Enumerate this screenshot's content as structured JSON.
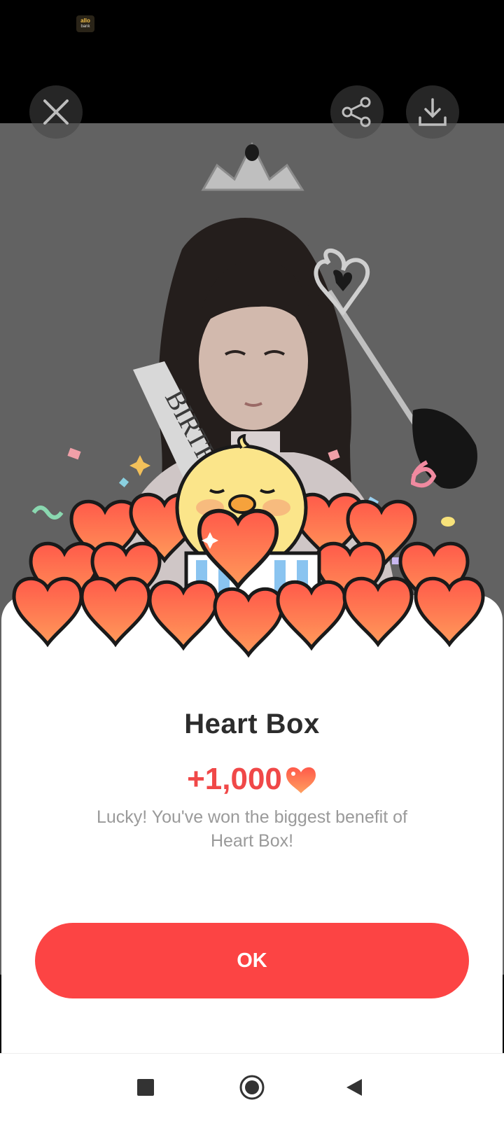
{
  "status_bar": {
    "app_badge_top": "allo",
    "app_badge_bottom": "bank"
  },
  "toolbar": {
    "close_icon": "close-icon",
    "share_icon": "share-icon",
    "download_icon": "download-icon"
  },
  "photo": {
    "sash_text": "BIRTH"
  },
  "dialog": {
    "title": "Heart Box",
    "reward": "+1,000",
    "reward_icon": "heart-icon",
    "message": "Lucky! You've won the biggest benefit of Heart Box!",
    "ok_label": "OK"
  },
  "nav": {
    "recents": "square-icon",
    "home": "circle-icon",
    "back": "triangle-back-icon"
  },
  "colors": {
    "accent": "#fc4444",
    "heart": "#f06a4a",
    "title": "#2c2c2c"
  }
}
